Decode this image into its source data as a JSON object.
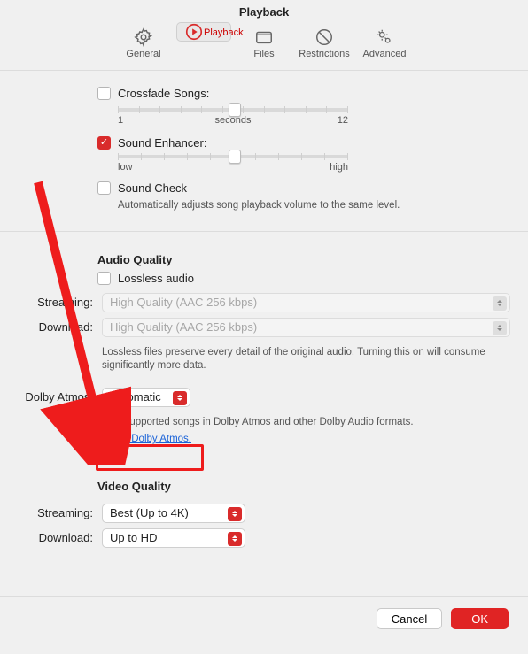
{
  "title": "Playback",
  "tabs": [
    "General",
    "Playback",
    "Files",
    "Restrictions",
    "Advanced"
  ],
  "crossfade": {
    "label": "Crossfade Songs:",
    "checked": false,
    "min_label": "1",
    "unit_label": "seconds",
    "max_label": "12"
  },
  "enhancer": {
    "label": "Sound Enhancer:",
    "checked": true,
    "min_label": "low",
    "max_label": "high"
  },
  "soundcheck": {
    "label": "Sound Check",
    "checked": false,
    "desc": "Automatically adjusts song playback volume to the same level."
  },
  "audio": {
    "head": "Audio Quality",
    "lossless_label": "Lossless audio",
    "lossless_checked": false,
    "streaming_label": "Streaming:",
    "streaming_value": "High Quality (AAC 256 kbps)",
    "download_label": "Download:",
    "download_value": "High Quality (AAC 256 kbps)",
    "desc": "Lossless files preserve every detail of the original audio. Turning this on will consume significantly more data."
  },
  "dolby": {
    "label": "Dolby Atmos:",
    "value": "Automatic",
    "desc": "Play supported songs in Dolby Atmos and other Dolby Audio formats.",
    "link": "About Dolby Atmos."
  },
  "video": {
    "head": "Video Quality",
    "streaming_label": "Streaming:",
    "streaming_value": "Best (Up to 4K)",
    "download_label": "Download:",
    "download_value": "Up to HD"
  },
  "footer": {
    "cancel": "Cancel",
    "ok": "OK"
  }
}
